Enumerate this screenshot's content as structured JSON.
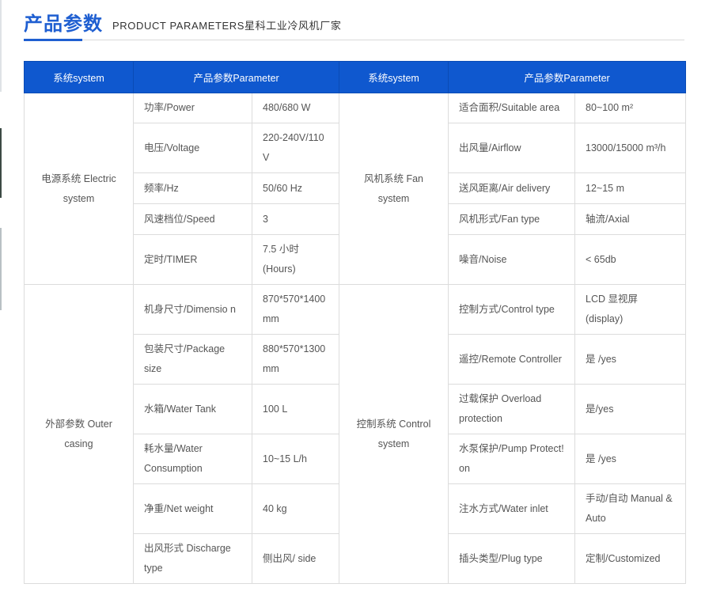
{
  "header": {
    "title": "产品参数",
    "subtitle": "PRODUCT PARAMETERS星科工业冷风机厂家"
  },
  "table": {
    "headers": [
      "系统system",
      "产品参数Parameter",
      "系统system",
      "产品参数Parameter"
    ],
    "groups": [
      {
        "left_system": "电源系统 Electric system",
        "right_system": "风机系统 Fan system",
        "rows": [
          {
            "l_name": "功率/Power",
            "l_value": "480/680 W",
            "r_name": "适合面积/Suitable area",
            "r_value": "80~100 m²"
          },
          {
            "l_name": "电压/Voltage",
            "l_value": "220-240V/110 V",
            "r_name": "出风量/Airflow",
            "r_value": "13000/15000 m³/h"
          },
          {
            "l_name": "频率/Hz",
            "l_value": "50/60 Hz",
            "r_name": "送风距离/Air delivery",
            "r_value": "12~15 m"
          },
          {
            "l_name": "风速档位/Speed",
            "l_value": "3",
            "r_name": "风机形式/Fan type",
            "r_value": "轴流/Axial"
          },
          {
            "l_name": "定时/TIMER",
            "l_value": "7.5 小时 (Hours)",
            "r_name": "噪音/Noise",
            "r_value": "< 65db"
          }
        ]
      },
      {
        "left_system": "外部参数 Outer casing",
        "right_system": "控制系统 Control system",
        "rows": [
          {
            "l_name": "机身尺寸/Dimensio n",
            "l_value": "870*570*1400 mm",
            "r_name": "控制方式/Control type",
            "r_value": "LCD 显视屏 (display)"
          },
          {
            "l_name": "包装尺寸/Package size",
            "l_value": "880*570*1300 mm",
            "r_name": "遥控/Remote Controller",
            "r_value": "是 /yes"
          },
          {
            "l_name": "水箱/Water Tank",
            "l_value": "100 L",
            "r_name": "过载保护 Overload protection",
            "r_value": "是/yes"
          },
          {
            "l_name": "耗水量/Water Consumption",
            "l_value": "10~15 L/h",
            "r_name": "水泵保护/Pump Protect! on",
            "r_value": "是 /yes"
          },
          {
            "l_name": "净重/Net weight",
            "l_value": "40 kg",
            "r_name": "注水方式/Water inlet",
            "r_value": "手动/自动 Manual & Auto"
          },
          {
            "l_name": "出风形式 Discharge type",
            "l_value": "侧出风/ side",
            "r_name": "插头类型/Plug type",
            "r_value": "定制/Customized"
          }
        ]
      }
    ]
  }
}
